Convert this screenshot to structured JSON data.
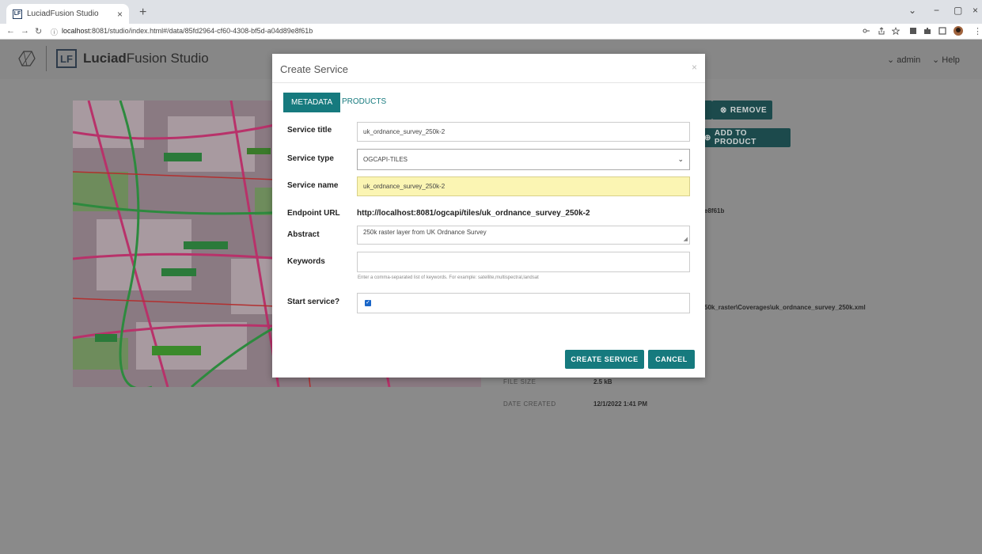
{
  "browser": {
    "tab_title": "LuciadFusion Studio",
    "favicon_text": "LF",
    "tab_close": "×",
    "new_tab": "+",
    "url_host": "localhost",
    "url_rest": ":8081/studio/index.html#/data/85fd2964-cf60-4308-bf5d-a04d89e8f61b"
  },
  "app": {
    "logo_text": "LF",
    "title_bold": "Luciad",
    "title_rest": "Fusion Studio",
    "menu_admin": "⌄ admin",
    "menu_help": "⌄ Help"
  },
  "background": {
    "remove_label": "REMOVE",
    "add_to_product_label": "ADD TO PRODUCT",
    "id_fragment": "e8f61b",
    "path_fragment": "50k_raster\\Coverages\\uk_ordnance_survey_250k.xml",
    "file_size_label": "FILE SIZE",
    "file_size_value": "2.5 kB",
    "date_created_label": "DATE CREATED",
    "date_created_value": "12/1/2022 1:41 PM"
  },
  "modal": {
    "title": "Create Service",
    "close": "×",
    "tab_metadata": "METADATA",
    "tab_products": "PRODUCTS",
    "service_title_label": "Service title",
    "service_title_value": "uk_ordnance_survey_250k-2",
    "service_type_label": "Service type",
    "service_type_value": "OGCAPI-TILES",
    "service_name_label": "Service name",
    "service_name_value": "uk_ordnance_survey_250k-2",
    "endpoint_label": "Endpoint URL",
    "endpoint_value": "http://localhost:8081/ogcapi/tiles/uk_ordnance_survey_250k-2",
    "abstract_label": "Abstract",
    "abstract_value": "250k raster layer from UK Ordnance Survey",
    "keywords_label": "Keywords",
    "keywords_value": "",
    "keywords_hint": "Enter a comma-separated list of keywords. For example: satellite,multispectral,landsat",
    "start_service_label": "Start service?",
    "start_service_checked": true,
    "create_button": "CREATE SERVICE",
    "cancel_button": "CANCEL"
  },
  "colors": {
    "accent": "#167a7e",
    "highlight": "#fbf5b3"
  }
}
